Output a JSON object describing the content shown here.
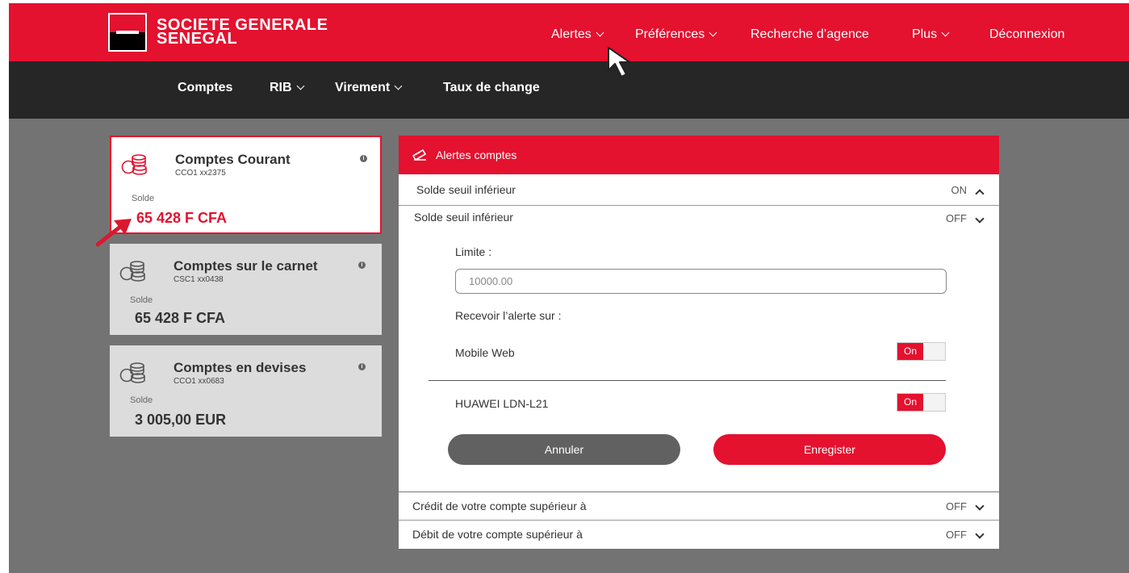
{
  "brand": {
    "line1": "SOCIETE GENERALE",
    "line2": "SENEGAL"
  },
  "topnav": {
    "alertes": "Alertes",
    "preferences": "Préférences",
    "recherche": "Recherche d’agence",
    "plus": "Plus",
    "deconnexion": "Déconnexion"
  },
  "subnav": {
    "comptes": "Comptes",
    "rib": "RIB",
    "virement": "Virement",
    "taux": "Taux de change"
  },
  "accounts": [
    {
      "title": "Comptes Courant",
      "number": "CCO1 xx2375",
      "solde_label": "Solde",
      "balance": "65 428 F CFA"
    },
    {
      "title": "Comptes sur le carnet",
      "number": "CSC1 xx0438",
      "solde_label": "Solde",
      "balance": "65 428 F CFA"
    },
    {
      "title": "Comptes en devises",
      "number": "CCO1 xx0683",
      "solde_label": "Solde",
      "balance": "3 005,00 EUR"
    }
  ],
  "alerts": {
    "title": "Alertes comptes",
    "rows": [
      {
        "label": "Solde seuil inférieur",
        "state": "ON"
      },
      {
        "label": "Solde seuil inférieur",
        "state": "OFF"
      },
      {
        "label": "Crédit de votre compte supérieur à",
        "state": "OFF"
      },
      {
        "label": "Débit de votre compte supérieur à",
        "state": "OFF"
      }
    ],
    "limit_label": "Limite :",
    "limit_value": "10000.00",
    "receive_label": "Recevoir l’alerte sur :",
    "channels": [
      {
        "name": "Mobile Web",
        "toggle": "On"
      },
      {
        "name": "HUAWEI LDN-L21",
        "toggle": "On"
      }
    ],
    "cancel": "Annuler",
    "save": "Enregister"
  },
  "colors": {
    "brand_red": "#e4112f",
    "dark_nav": "#262626",
    "background": "#737373"
  }
}
